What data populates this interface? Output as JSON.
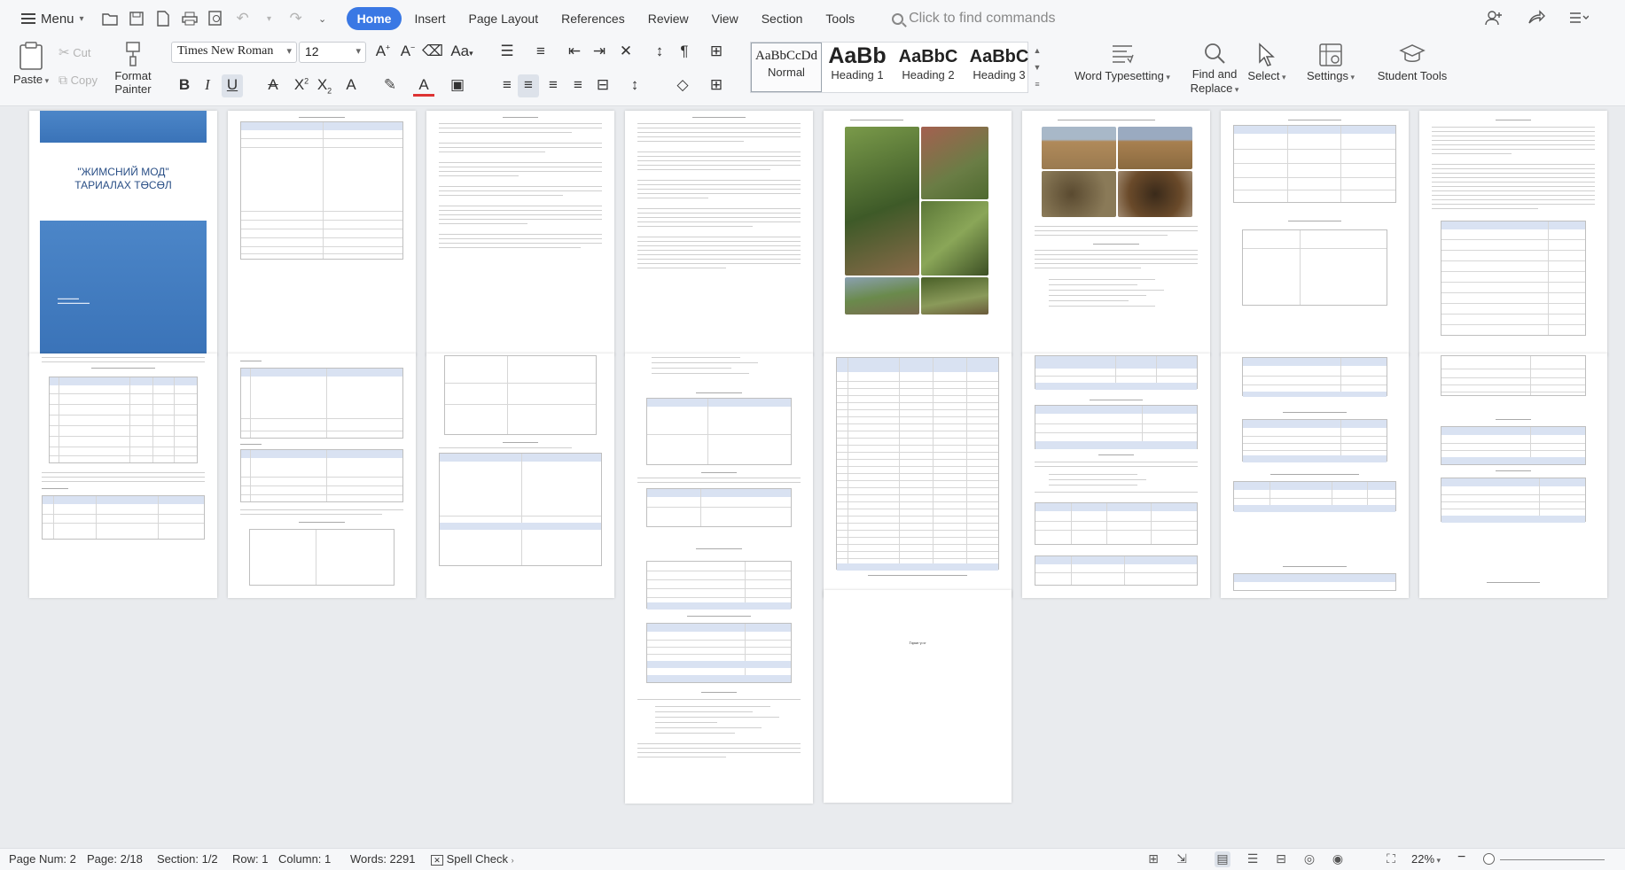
{
  "menubar": {
    "menu_label": "Menu",
    "tabs": [
      {
        "label": "Home",
        "active": true
      },
      {
        "label": "Insert",
        "active": false
      },
      {
        "label": "Page Layout",
        "active": false
      },
      {
        "label": "References",
        "active": false
      },
      {
        "label": "Review",
        "active": false
      },
      {
        "label": "View",
        "active": false
      },
      {
        "label": "Section",
        "active": false
      },
      {
        "label": "Tools",
        "active": false
      }
    ],
    "search_placeholder": "Click to find commands"
  },
  "ribbon": {
    "paste": "Paste",
    "cut": "Cut",
    "copy": "Copy",
    "format_painter_1": "Format",
    "format_painter_2": "Painter",
    "font_name": "Times New Roman",
    "font_size": "12",
    "styles": [
      {
        "preview": "AaBbCcDd",
        "name": "Normal"
      },
      {
        "preview": "AaBb",
        "name": "Heading 1"
      },
      {
        "preview": "AaBbC",
        "name": "Heading 2"
      },
      {
        "preview": "AaBbC",
        "name": "Heading 3"
      }
    ],
    "word_typesetting": "Word Typesetting",
    "find_replace_1": "Find and",
    "find_replace_2": "Replace",
    "select": "Select",
    "settings": "Settings",
    "student_tools": "Student Tools"
  },
  "document": {
    "cover_title_line1": "\"ЖИМСНИЙ МОД\"",
    "cover_title_line2": "ТАРИАЛАХ ТӨСӨЛ",
    "last_page_text": "Гарын үсэг",
    "accent_color": "#3a78e4"
  },
  "status": {
    "page_num": "Page Num: 2",
    "page": "Page: 2/18",
    "section": "Section: 1/2",
    "row": "Row: 1",
    "column": "Column: 1",
    "words": "Words: 2291",
    "spell_check": "Spell Check",
    "zoom": "22%"
  }
}
